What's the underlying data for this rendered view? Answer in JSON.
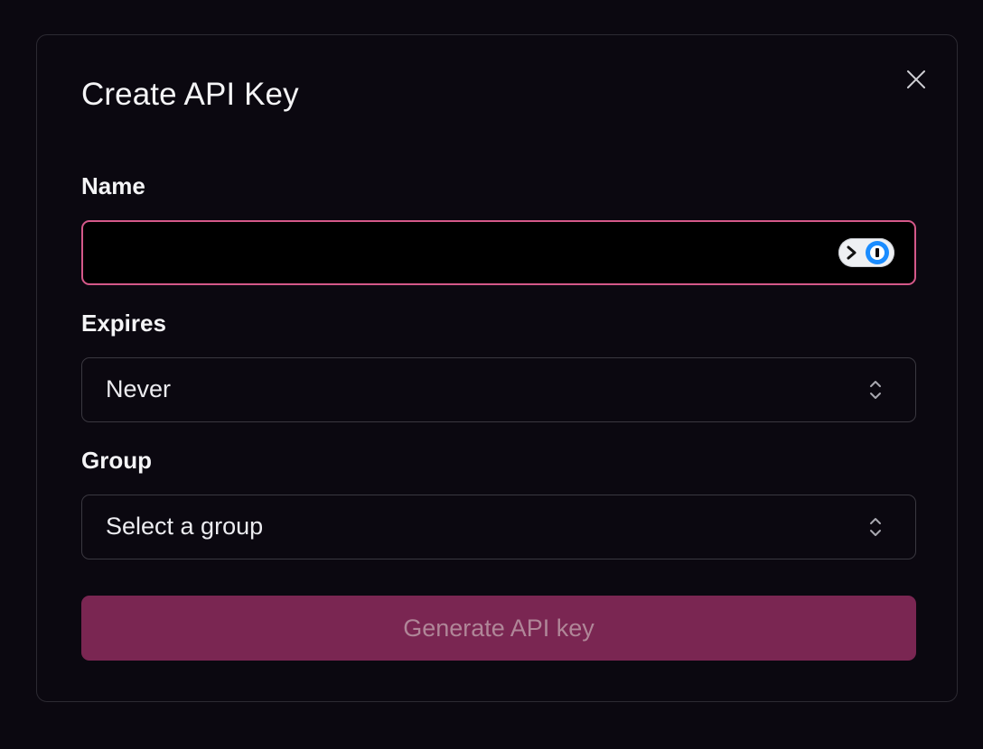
{
  "dialog": {
    "title": "Create API Key",
    "close_icon": "close-icon"
  },
  "form": {
    "name": {
      "label": "Name",
      "value": "",
      "placeholder": "",
      "autofill_icon": "password-manager-icon"
    },
    "expires": {
      "label": "Expires",
      "selected": "Never",
      "caret_icon": "chevron-up-down-icon"
    },
    "group": {
      "label": "Group",
      "selected": "Select a group",
      "caret_icon": "chevron-up-down-icon"
    },
    "submit_label": "Generate API key"
  },
  "colors": {
    "background": "#0b0810",
    "accent": "#d45889",
    "button_bg": "#7a2652",
    "button_text": "#b08698",
    "border": "#3a3840"
  }
}
